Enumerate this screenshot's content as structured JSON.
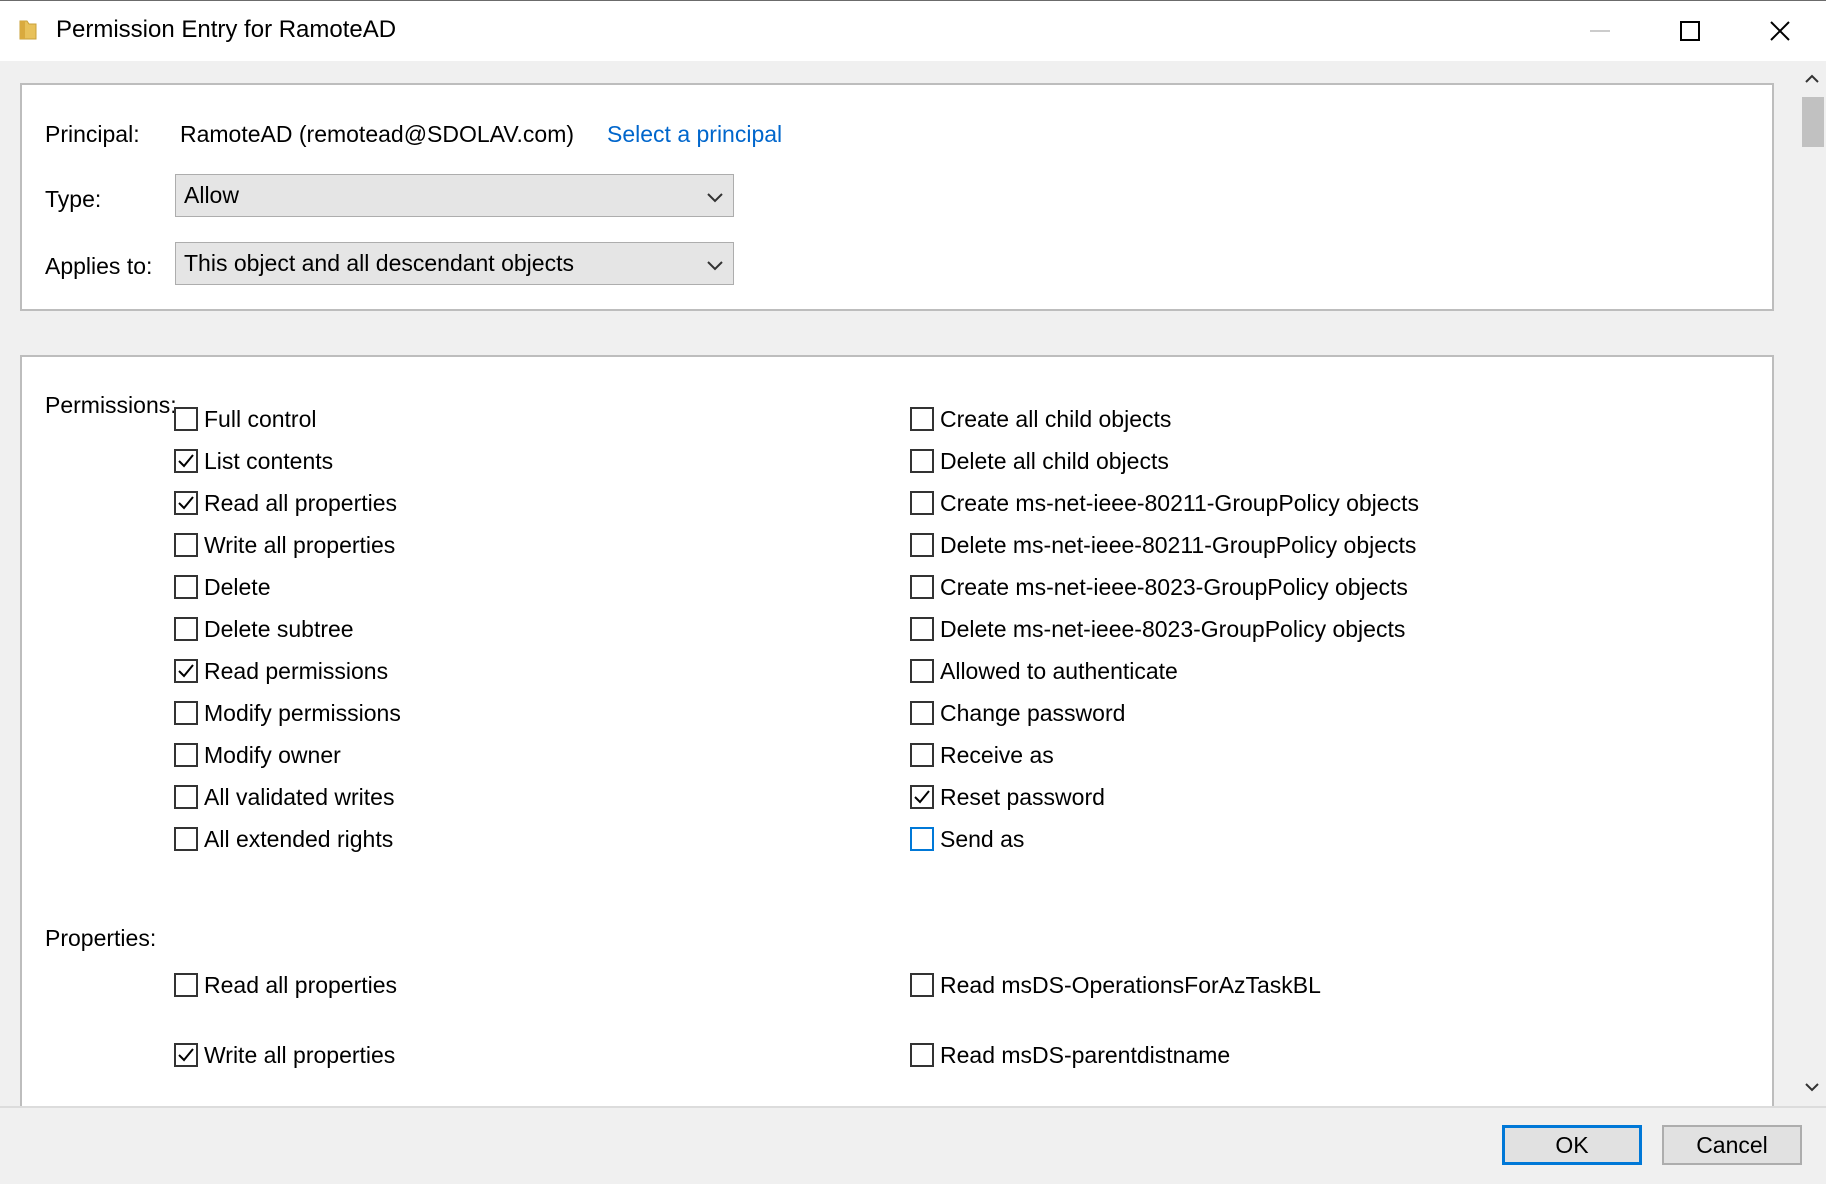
{
  "window": {
    "title": "Permission Entry for RamoteAD"
  },
  "principal": {
    "label": "Principal:",
    "value": "RamoteAD (remotead@SDOLAV.com)",
    "select_link": "Select a principal"
  },
  "type": {
    "label": "Type:",
    "value": "Allow"
  },
  "applies_to": {
    "label": "Applies to:",
    "value": "This object and all descendant objects"
  },
  "permissions": {
    "label": "Permissions:",
    "left": [
      {
        "label": "Full control",
        "checked": false
      },
      {
        "label": "List contents",
        "checked": true
      },
      {
        "label": "Read all properties",
        "checked": true
      },
      {
        "label": "Write all properties",
        "checked": false
      },
      {
        "label": "Delete",
        "checked": false
      },
      {
        "label": "Delete subtree",
        "checked": false
      },
      {
        "label": "Read permissions",
        "checked": true
      },
      {
        "label": "Modify permissions",
        "checked": false
      },
      {
        "label": "Modify owner",
        "checked": false
      },
      {
        "label": "All validated writes",
        "checked": false
      },
      {
        "label": "All extended rights",
        "checked": false
      }
    ],
    "right": [
      {
        "label": "Create all child objects",
        "checked": false
      },
      {
        "label": "Delete all child objects",
        "checked": false
      },
      {
        "label": "Create ms-net-ieee-80211-GroupPolicy objects",
        "checked": false
      },
      {
        "label": "Delete ms-net-ieee-80211-GroupPolicy objects",
        "checked": false
      },
      {
        "label": "Create ms-net-ieee-8023-GroupPolicy objects",
        "checked": false
      },
      {
        "label": "Delete ms-net-ieee-8023-GroupPolicy objects",
        "checked": false
      },
      {
        "label": "Allowed to authenticate",
        "checked": false
      },
      {
        "label": "Change password",
        "checked": false
      },
      {
        "label": "Receive as",
        "checked": false
      },
      {
        "label": "Reset password",
        "checked": true
      },
      {
        "label": "Send as",
        "checked": false,
        "focused": true
      }
    ]
  },
  "properties": {
    "label": "Properties:",
    "left": [
      {
        "label": "Read all properties",
        "checked": false
      },
      {
        "label": "Write all properties",
        "checked": true
      }
    ],
    "right": [
      {
        "label": "Read msDS-OperationsForAzTaskBL",
        "checked": false
      },
      {
        "label": "Read msDS-parentdistname",
        "checked": false
      }
    ]
  },
  "buttons": {
    "ok": "OK",
    "cancel": "Cancel"
  },
  "colors": {
    "accent": "#0078d7",
    "link": "#0066cc",
    "panel": "#f0f0f0"
  }
}
